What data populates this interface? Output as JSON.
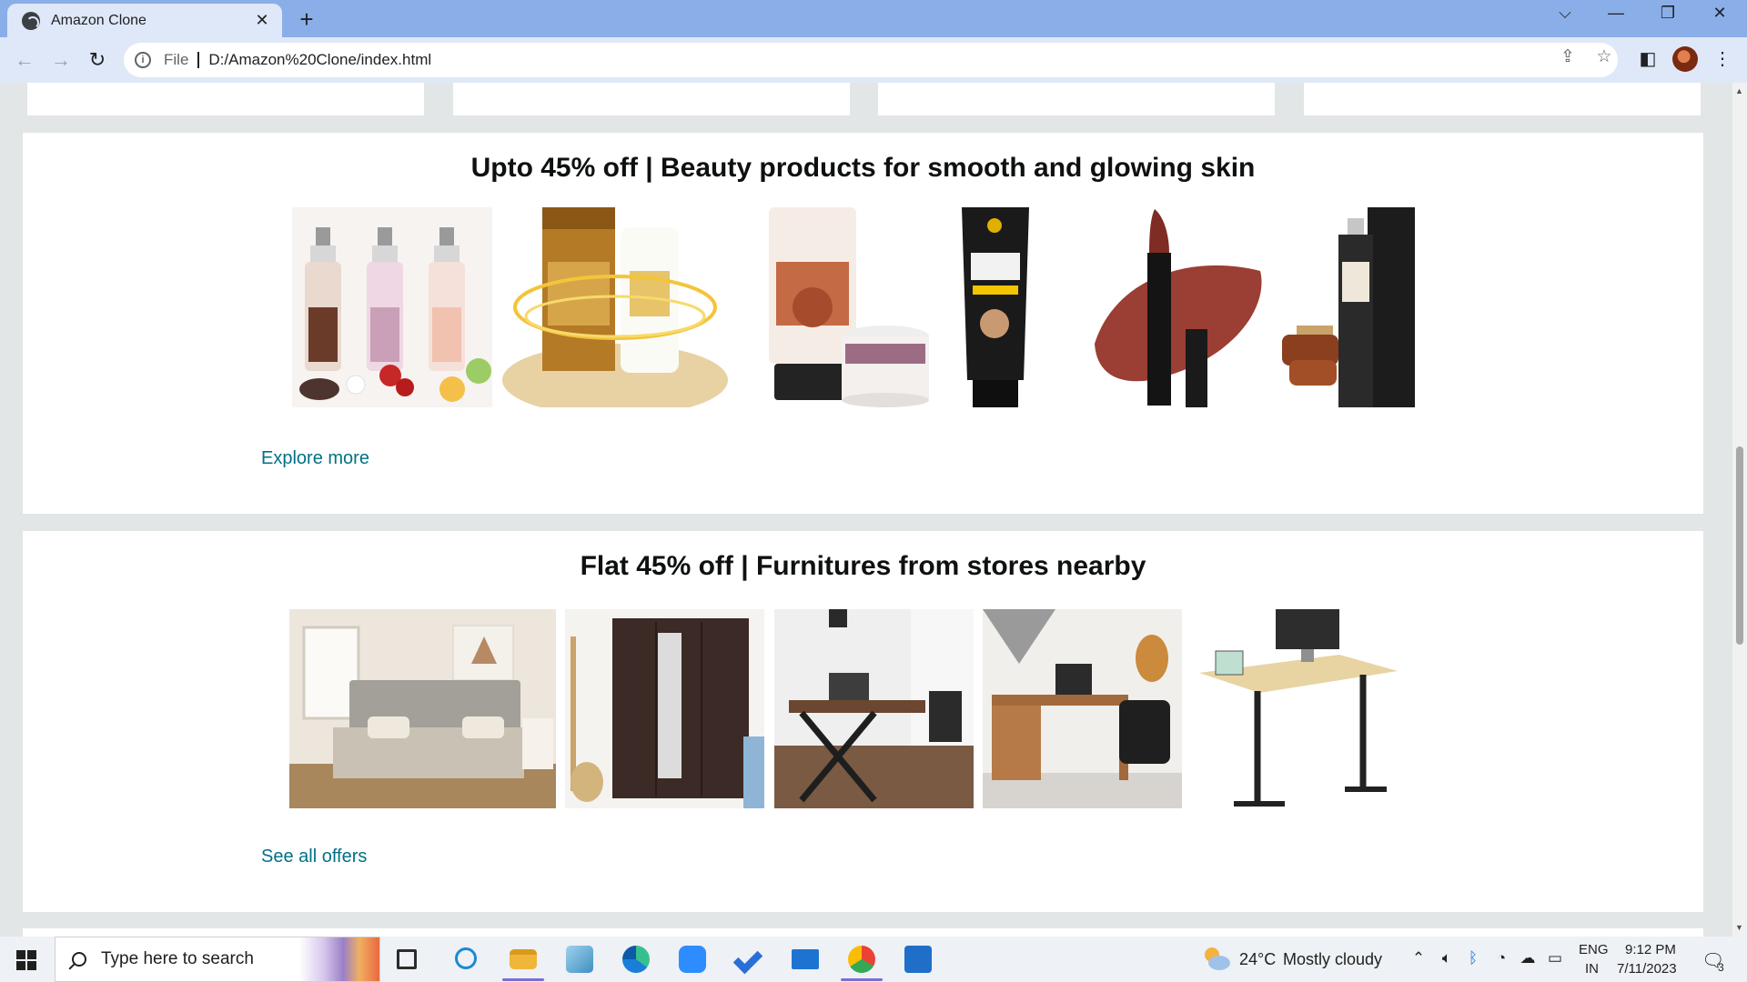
{
  "browser": {
    "tab_title": "Amazon Clone",
    "new_tab": "+",
    "window_controls": {
      "tab_search": "⌵",
      "minimize": "—",
      "restore": "❐",
      "close": "✕"
    },
    "tab_close": "✕",
    "nav": {
      "back": "←",
      "forward": "→",
      "reload": "↻"
    },
    "address": {
      "scheme": "File",
      "url": "D:/Amazon%20Clone/index.html",
      "info_icon": "i"
    },
    "address_actions": {
      "share": "⇪",
      "bookmark": "☆"
    },
    "toolbar_actions": {
      "side_panel": "◧",
      "menu": "⋮"
    }
  },
  "page": {
    "beauty_section": {
      "title": "Upto 45% off | Beauty products for smooth and glowing skin",
      "link": "Explore more",
      "products": [
        {
          "icon": "perfume-mist-bottles-image"
        },
        {
          "icon": "murtela-gold-cream-image"
        },
        {
          "icon": "bodycare-facewash-mudmask-image"
        },
        {
          "icon": "wellskin-charcoal-peel-image"
        },
        {
          "icon": "lipstick-swatch-image"
        },
        {
          "icon": "antonia-perfume-image"
        }
      ]
    },
    "furniture_section": {
      "title": "Flat 45% off | Furnitures from stores nearby",
      "link": "See all offers",
      "products": [
        {
          "icon": "bed-image"
        },
        {
          "icon": "wardrobe-image"
        },
        {
          "icon": "x-frame-desk-image"
        },
        {
          "icon": "study-desk-chair-image"
        },
        {
          "icon": "standing-desk-image"
        }
      ]
    }
  },
  "taskbar": {
    "search_placeholder": "Type here to search",
    "weather": {
      "temp": "24°C",
      "condition": "Mostly cloudy"
    },
    "tray": {
      "language": "ENG",
      "region": "IN",
      "time": "9:12 PM",
      "date": "7/11/2023",
      "notifications": "3"
    },
    "apps": [
      "task-view",
      "cortana",
      "file-explorer",
      "notepad",
      "edge",
      "zoom",
      "todo",
      "mail",
      "chrome",
      "store"
    ]
  },
  "colors": {
    "link": "#007185",
    "tabbar": "#8aaee8",
    "toolbar": "#dfe8f8",
    "page_bg": "#e3e6e6"
  }
}
